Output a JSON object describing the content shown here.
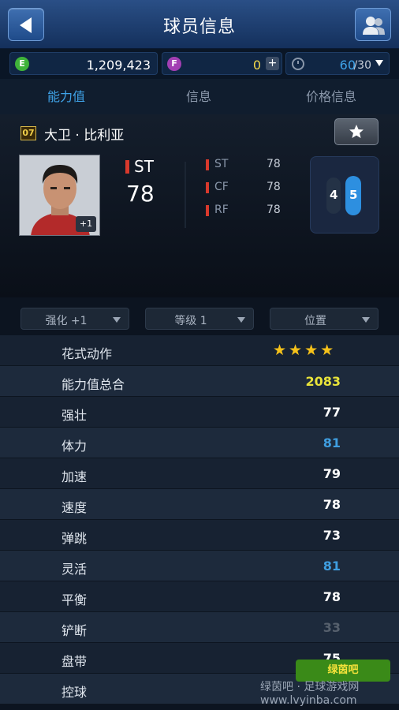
{
  "header": {
    "title": "球员信息",
    "back_icon": "back-arrow-icon",
    "friends_icon": "friends-icon"
  },
  "currency": {
    "ep": {
      "icon_letter": "E",
      "value": "1,209,423",
      "color": "#3fb33a"
    },
    "fp": {
      "icon_letter": "F",
      "value": "0",
      "color": "#a23fb3",
      "value_color": "#f2d84a"
    },
    "energy": {
      "current": "60",
      "max": "/30"
    }
  },
  "tabs": [
    {
      "label": "能力值",
      "active": true
    },
    {
      "label": "信息",
      "active": false
    },
    {
      "label": "价格信息",
      "active": false
    }
  ],
  "player": {
    "badge": "07",
    "name": "大卫 · 比利亚",
    "main_position": "ST",
    "main_overall": "78",
    "enhance_badge": "+1",
    "alt_positions": [
      {
        "pos": "ST",
        "value": "78"
      },
      {
        "pos": "CF",
        "value": "78"
      },
      {
        "pos": "RF",
        "value": "78"
      }
    ],
    "weak_foot": "4",
    "strong_foot": "5"
  },
  "filters": [
    {
      "label": "强化 +1"
    },
    {
      "label": "等级 1"
    },
    {
      "label": "位置"
    }
  ],
  "stats": [
    {
      "name": "花式动作",
      "value": "",
      "stars": 4
    },
    {
      "name": "能力值总合",
      "value": "2083",
      "color": "#e8e33a"
    },
    {
      "name": "强壮",
      "value": "77",
      "color": "#ffffff"
    },
    {
      "name": "体力",
      "value": "81",
      "color": "#3f9ee0"
    },
    {
      "name": "加速",
      "value": "79",
      "color": "#ffffff"
    },
    {
      "name": "速度",
      "value": "78",
      "color": "#ffffff"
    },
    {
      "name": "弹跳",
      "value": "73",
      "color": "#ffffff"
    },
    {
      "name": "灵活",
      "value": "81",
      "color": "#3f9ee0"
    },
    {
      "name": "平衡",
      "value": "78",
      "color": "#ffffff"
    },
    {
      "name": "铲断",
      "value": "33",
      "color": "#56606d"
    },
    {
      "name": "盘带",
      "value": "75",
      "color": "#ffffff"
    },
    {
      "name": "控球",
      "value": "",
      "color": "#ffffff"
    }
  ],
  "watermark": {
    "text": "绿茵吧 · 足球游戏网 www.lvyinba.com"
  }
}
